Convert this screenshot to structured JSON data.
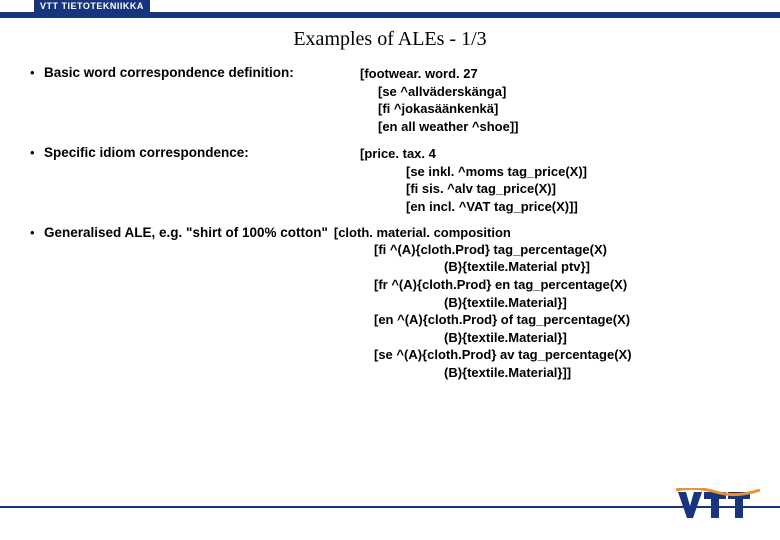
{
  "header": {
    "org": "VTT TIETOTEKNIIKKA"
  },
  "title": "Examples of ALEs  - 1/3",
  "rows": [
    {
      "bullet": "Basic word  correspondence definition:",
      "right": [
        "[footwear. word. 27",
        "[se ^allväderskänga]",
        "[fi ^jokasäänkenkä]",
        "[en all weather ^shoe]]"
      ]
    },
    {
      "bullet": "Specific idiom correspondence:",
      "right": [
        "[price. tax. 4",
        "[se inkl. ^moms tag_price(X)]",
        "[fi sis. ^alv tag_price(X)]",
        "[en incl. ^VAT tag_price(X)]]"
      ]
    },
    {
      "bullet": "Generalised ALE, e.g. \"shirt of 100% cotton\"",
      "right_lead": "[cloth. material. composition",
      "right": [
        "[fi  ^(A){cloth.Prod} tag_percentage(X)",
        "(B){textile.Material ptv}]",
        "[fr ^(A){cloth.Prod}  en tag_percentage(X)",
        "(B){textile.Material}]",
        "[en ^(A){cloth.Prod} of tag_percentage(X)",
        "(B){textile.Material}]",
        "[se ^(A){cloth.Prod} av tag_percentage(X)",
        "(B){textile.Material}]]"
      ]
    }
  ],
  "logo_text": "VTT"
}
